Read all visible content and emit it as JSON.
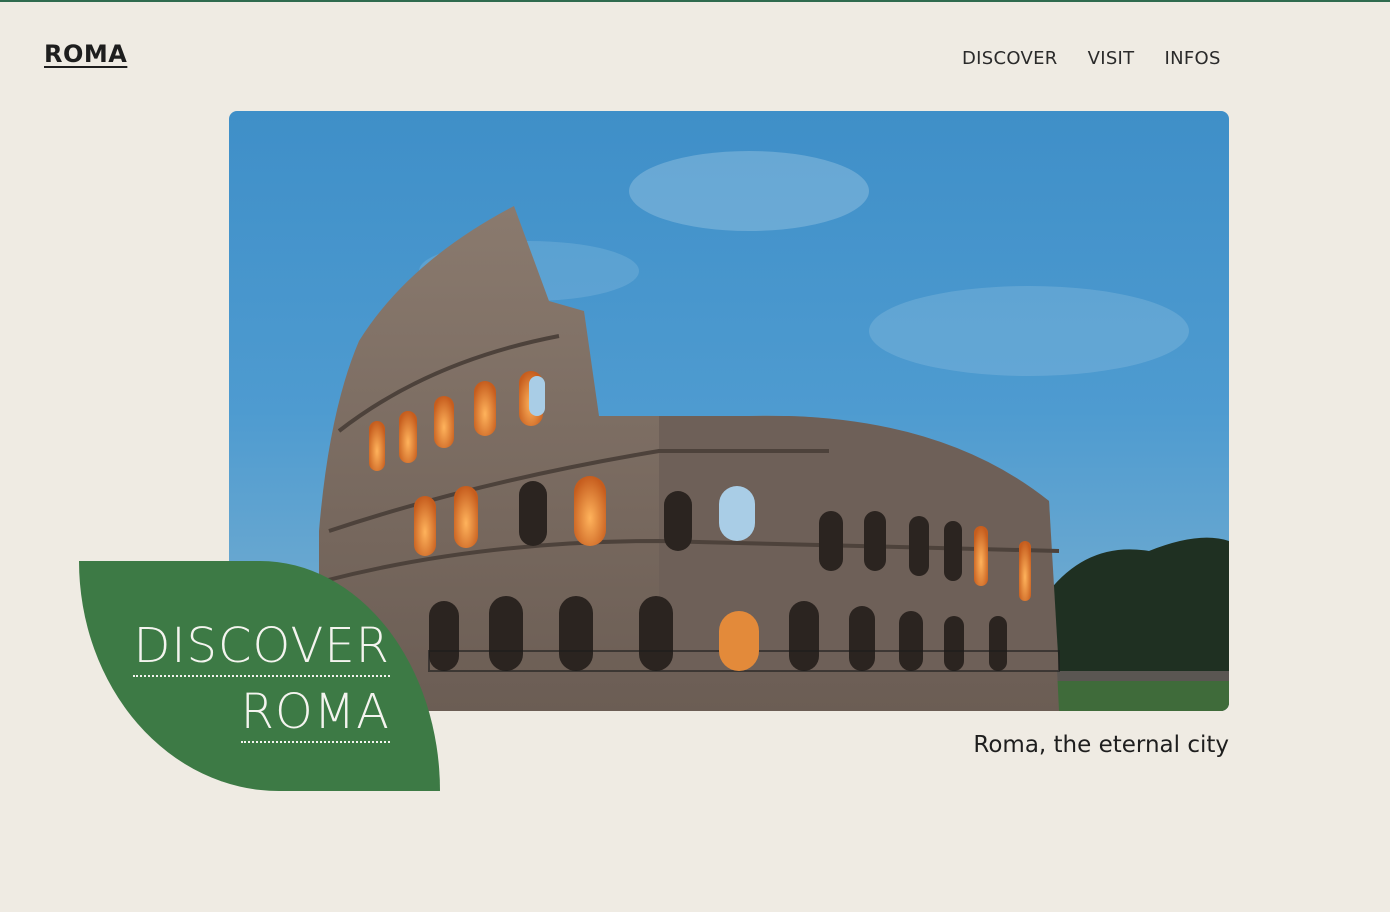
{
  "header": {
    "logo": "ROMA",
    "nav": [
      "DISCOVER",
      "VISIT",
      "INFOS"
    ]
  },
  "hero": {
    "image_alt": "Colosseum at dusk",
    "badge_line1": "DISCOVER",
    "badge_line2": "ROMA",
    "caption": "Roma, the eternal city"
  },
  "colors": {
    "background": "#efebe3",
    "accent_green": "#3d7a45",
    "top_border": "#2f6b4f"
  }
}
